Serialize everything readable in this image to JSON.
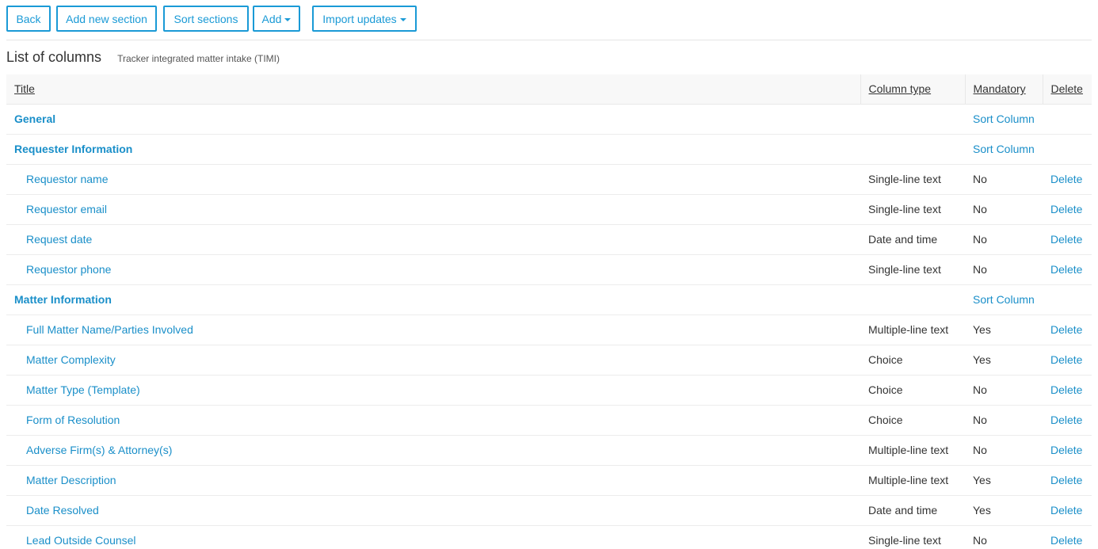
{
  "toolbar": {
    "back": "Back",
    "add_section": "Add new section",
    "sort_sections": "Sort sections",
    "add": "Add",
    "import_updates": "Import updates"
  },
  "heading": {
    "title": "List of columns",
    "subtitle": "Tracker integrated matter intake (TIMI)"
  },
  "table": {
    "headers": {
      "title": "Title",
      "column_type": "Column type",
      "mandatory": "Mandatory",
      "delete": "Delete"
    },
    "sort_label": "Sort Column",
    "delete_label": "Delete",
    "rows": [
      {
        "kind": "section",
        "title": "General"
      },
      {
        "kind": "section",
        "title": "Requester Information"
      },
      {
        "kind": "column",
        "title": "Requestor name",
        "type": "Single-line text",
        "mandatory": "No"
      },
      {
        "kind": "column",
        "title": "Requestor email",
        "type": "Single-line text",
        "mandatory": "No"
      },
      {
        "kind": "column",
        "title": "Request date",
        "type": "Date and time",
        "mandatory": "No"
      },
      {
        "kind": "column",
        "title": "Requestor phone",
        "type": "Single-line text",
        "mandatory": "No"
      },
      {
        "kind": "section",
        "title": "Matter Information"
      },
      {
        "kind": "column",
        "title": "Full Matter Name/Parties Involved",
        "type": "Multiple-line text",
        "mandatory": "Yes"
      },
      {
        "kind": "column",
        "title": "Matter Complexity",
        "type": "Choice",
        "mandatory": "Yes"
      },
      {
        "kind": "column",
        "title": "Matter Type (Template)",
        "type": "Choice",
        "mandatory": "No"
      },
      {
        "kind": "column",
        "title": "Form of Resolution",
        "type": "Choice",
        "mandatory": "No"
      },
      {
        "kind": "column",
        "title": "Adverse Firm(s) & Attorney(s)",
        "type": "Multiple-line text",
        "mandatory": "No"
      },
      {
        "kind": "column",
        "title": "Matter Description",
        "type": "Multiple-line text",
        "mandatory": "Yes"
      },
      {
        "kind": "column",
        "title": "Date Resolved",
        "type": "Date and time",
        "mandatory": "Yes"
      },
      {
        "kind": "column",
        "title": "Lead Outside Counsel",
        "type": "Single-line text",
        "mandatory": "No"
      }
    ]
  },
  "colors": {
    "accent": "#1a9ad6",
    "link": "#1a8fc9",
    "header_bg": "#f8f8f8"
  },
  "icons": {
    "dropdown": "caret-down-icon"
  }
}
